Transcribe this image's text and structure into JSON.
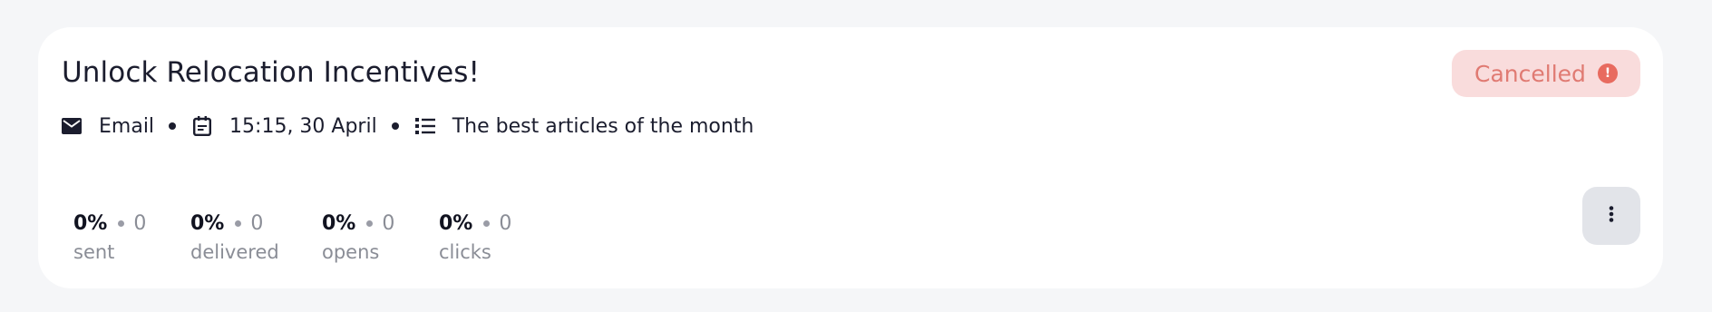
{
  "campaign": {
    "title": "Unlock Relocation Incentives!",
    "status": "Cancelled",
    "status_icon": "alert-circle-icon",
    "status_color": "#e07a72",
    "status_bg": "#f9dcdc"
  },
  "meta": {
    "channel_icon": "envelope-icon",
    "channel": "Email",
    "date_icon": "calendar-icon",
    "datetime": "15:15, 30 April",
    "list_icon": "list-icon",
    "list_name": "The best articles of the month"
  },
  "stats": [
    {
      "pct": "0%",
      "count": "0",
      "label": "sent"
    },
    {
      "pct": "0%",
      "count": "0",
      "label": "delivered"
    },
    {
      "pct": "0%",
      "count": "0",
      "label": "opens"
    },
    {
      "pct": "0%",
      "count": "0",
      "label": "clicks"
    }
  ],
  "actions": {
    "more_icon": "more-vertical-icon"
  }
}
